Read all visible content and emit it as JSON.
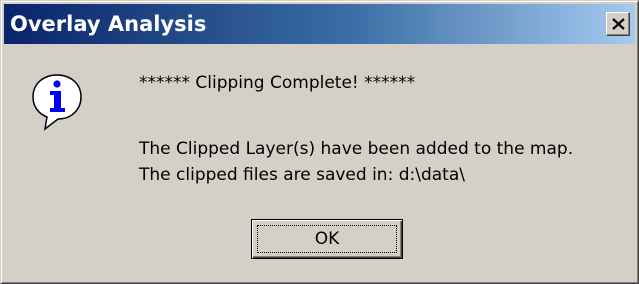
{
  "dialog": {
    "title": "Overlay Analysis",
    "close_icon": "close-x-icon",
    "icon": "information-icon",
    "messages": [
      "****** Clipping Complete! ******",
      "The Clipped Layer(s) have been added to the map.",
      "The clipped files are saved in:  d:\\data\\"
    ],
    "ok_label": "OK"
  },
  "colors": {
    "titlebar_start": "#0a246a",
    "titlebar_end": "#a6caf0",
    "dialog_bg": "#d4d0c8",
    "icon_blue": "#0000ff"
  }
}
